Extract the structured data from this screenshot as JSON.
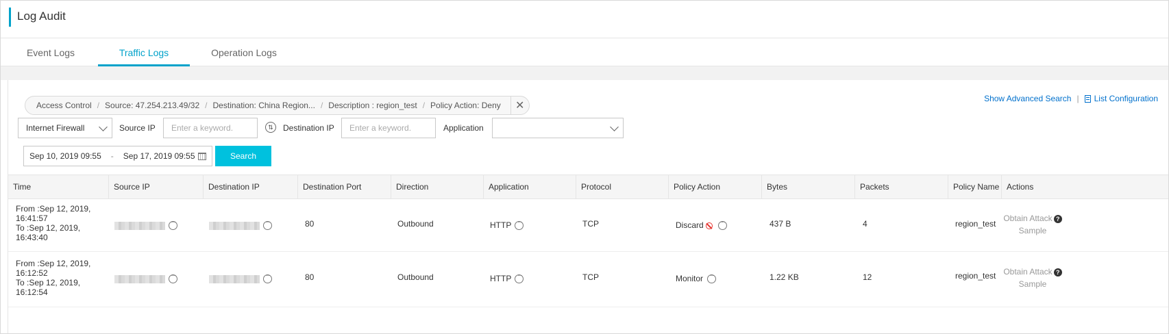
{
  "page_title": "Log Audit",
  "tabs": [
    {
      "label": "Event Logs",
      "active": false
    },
    {
      "label": "Traffic Logs",
      "active": true
    },
    {
      "label": "Operation Logs",
      "active": false
    }
  ],
  "filter_chips": [
    "Access Control",
    "Source: 47.254.213.49/32",
    "Destination: China Region...",
    "Description : region_test",
    "Policy Action: Deny"
  ],
  "top_links": {
    "advanced_search": "Show Advanced Search",
    "separator": "|",
    "list_config": "List Configuration"
  },
  "filters": {
    "firewall_select": "Internet Firewall",
    "source_ip_label": "Source IP",
    "source_ip_placeholder": "Enter a keyword.",
    "destination_ip_label": "Destination IP",
    "destination_ip_placeholder": "Enter a keyword.",
    "application_label": "Application",
    "application_value": "",
    "date_from": "Sep 10, 2019 09:55",
    "date_sep": "-",
    "date_to": "Sep 17, 2019 09:55",
    "search_button": "Search"
  },
  "table": {
    "columns": [
      "Time",
      "Source IP",
      "Destination IP",
      "Destination Port",
      "Direction",
      "Application",
      "Protocol",
      "Policy Action",
      "Bytes",
      "Packets",
      "Policy Name",
      "Actions"
    ],
    "rows": [
      {
        "time_from": "From :Sep 12, 2019, 16:41:57",
        "time_to": "To :Sep 12, 2019, 16:43:40",
        "dest_port": "80",
        "direction": "Outbound",
        "application": "HTTP",
        "protocol": "TCP",
        "policy_action": "Discard",
        "policy_action_blocked": true,
        "bytes": "437 B",
        "packets": "4",
        "policy_name": "region_test",
        "action_line1": "Obtain Attack",
        "action_line2": "Sample"
      },
      {
        "time_from": "From :Sep 12, 2019, 16:12:52",
        "time_to": "To :Sep 12, 2019, 16:12:54",
        "dest_port": "80",
        "direction": "Outbound",
        "application": "HTTP",
        "protocol": "TCP",
        "policy_action": "Monitor",
        "policy_action_blocked": false,
        "bytes": "1.22 KB",
        "packets": "12",
        "policy_name": "region_test",
        "action_line1": "Obtain Attack",
        "action_line2": "Sample"
      }
    ]
  },
  "colors": {
    "accent": "#00a2ca",
    "search_button": "#00c1de",
    "link": "#0070cc",
    "blocked": "#e5322d"
  },
  "icons": [
    "chevron-down-icon",
    "swap-icon",
    "calendar-icon",
    "close-icon",
    "list-config-icon",
    "more-icon",
    "ban-icon",
    "help-icon"
  ]
}
